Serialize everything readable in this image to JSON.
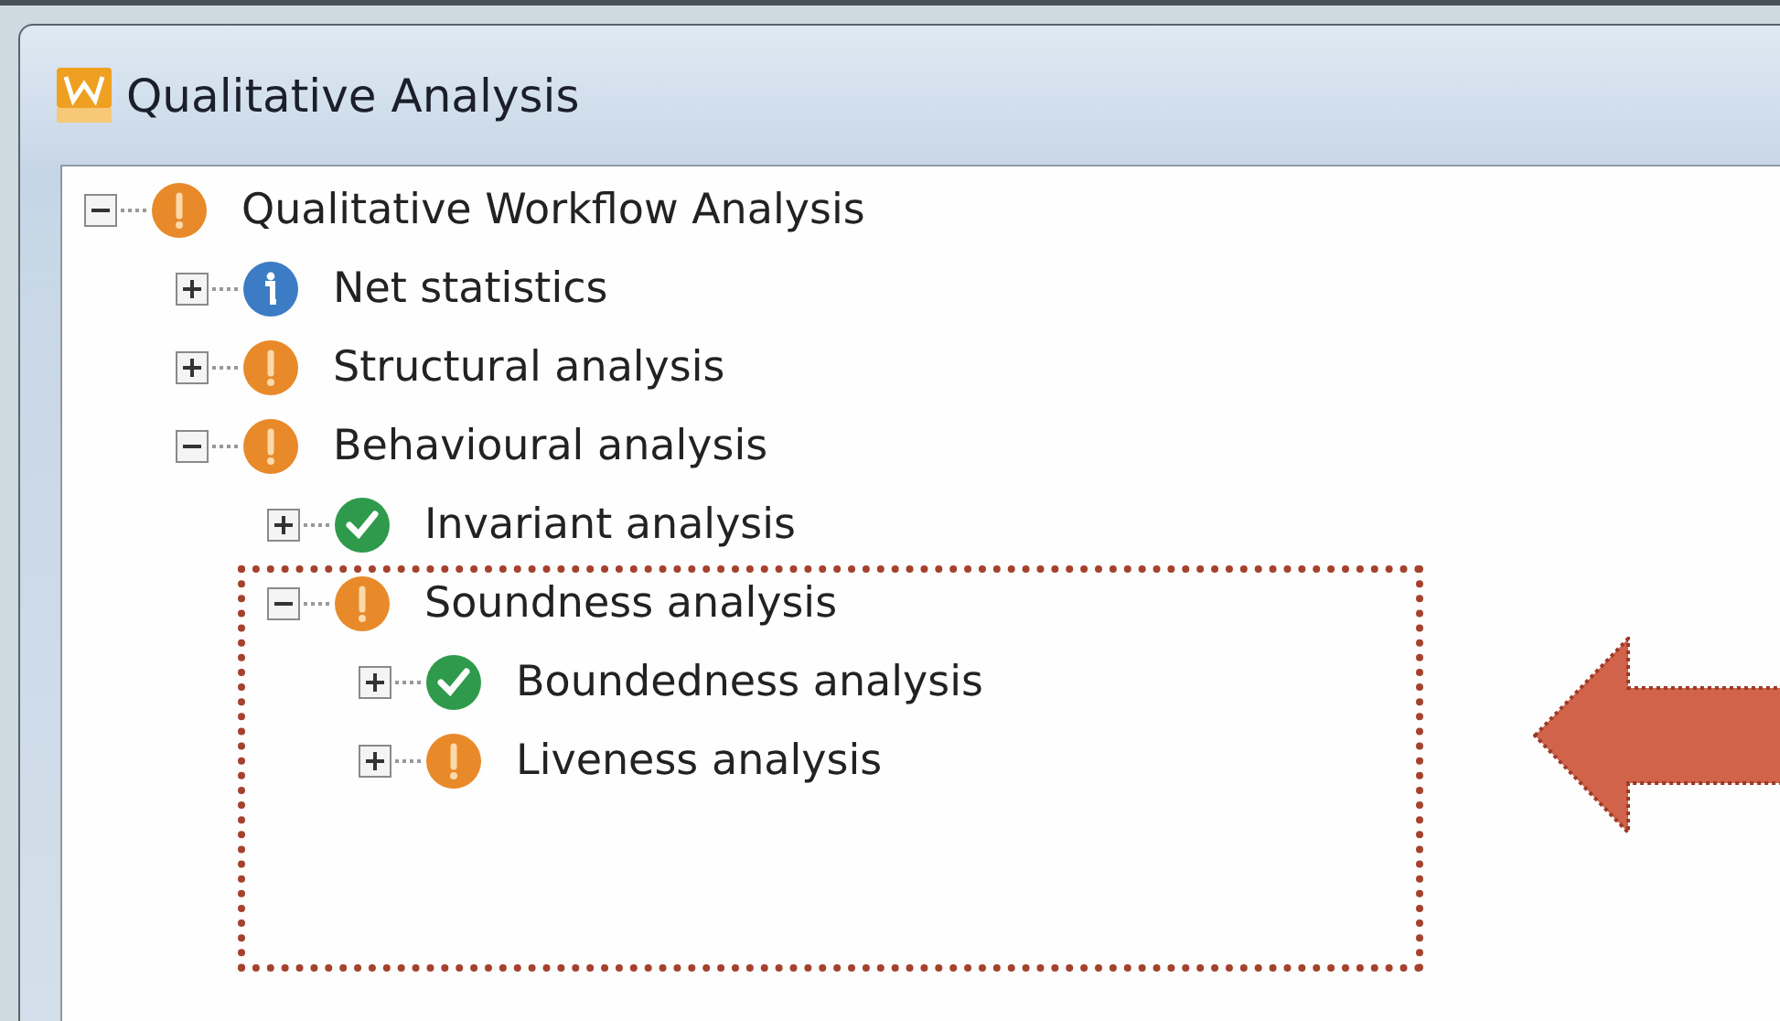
{
  "window": {
    "title": "Qualitative Analysis"
  },
  "tree": [
    {
      "label": "Qualitative Workflow Analysis",
      "kind": "warning",
      "expanded": true,
      "children": [
        {
          "label": "Net statistics",
          "kind": "info",
          "expanded": false
        },
        {
          "label": "Structural analysis",
          "kind": "warning",
          "expanded": false
        },
        {
          "label": "Behavioural analysis",
          "kind": "warning",
          "expanded": true,
          "children": [
            {
              "label": "Invariant analysis",
              "kind": "ok",
              "expanded": false
            },
            {
              "label": "Soundness analysis",
              "kind": "warning",
              "expanded": true,
              "children": [
                {
                  "label": "Boundedness analysis",
                  "kind": "ok",
                  "expanded": false
                },
                {
                  "label": "Liveness analysis",
                  "kind": "warning",
                  "expanded": false
                }
              ]
            }
          ]
        }
      ]
    }
  ]
}
